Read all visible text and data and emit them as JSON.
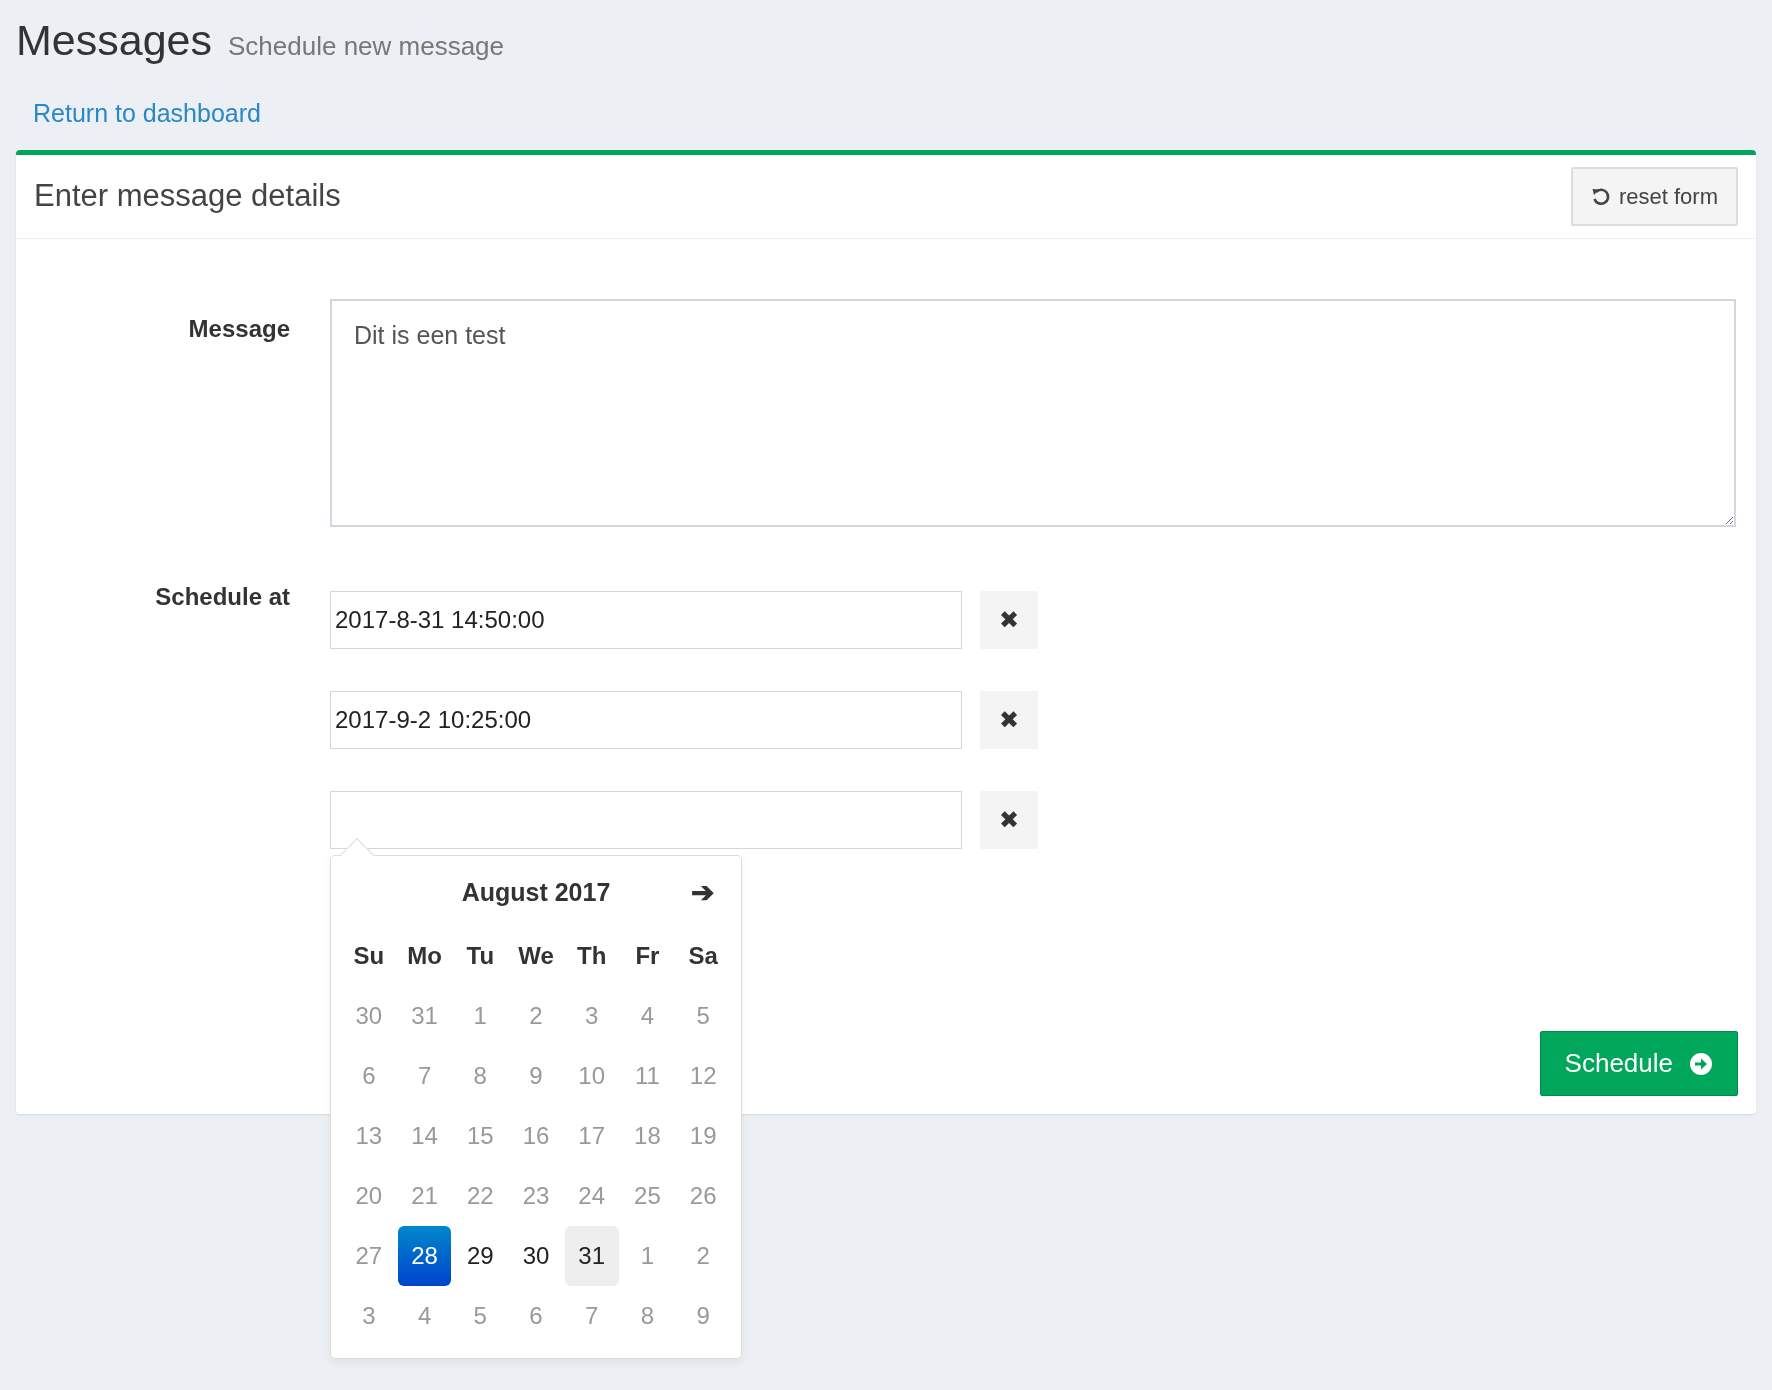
{
  "page": {
    "title": "Messages",
    "subtitle": "Schedule new message"
  },
  "back_link": "Return to dashboard",
  "card": {
    "title": "Enter message details",
    "reset_button": "reset form"
  },
  "message": {
    "label": "Message",
    "value": "Dit is een test"
  },
  "schedule": {
    "label": "Schedule at",
    "remove_label": "✖",
    "fields": [
      {
        "value": "2017-8-31 14:50:00"
      },
      {
        "value": "2017-9-2 10:25:00"
      },
      {
        "datepicker": {
          "month": "August 2017",
          "next": "➔",
          "weekdays": [
            "Su",
            "Mo",
            "Tu",
            "We",
            "Th",
            "Fr",
            "Sa"
          ],
          "weeks": [
            [
              {
                "label": "30",
                "disabled": true,
                "selected": false,
                "highlighted": false
              },
              {
                "label": "31",
                "disabled": true,
                "selected": false,
                "highlighted": false
              },
              {
                "label": "1",
                "disabled": true,
                "selected": false,
                "highlighted": false
              },
              {
                "label": "2",
                "disabled": true,
                "selected": false,
                "highlighted": false
              },
              {
                "label": "3",
                "disabled": true,
                "selected": false,
                "highlighted": false
              },
              {
                "label": "4",
                "disabled": true,
                "selected": false,
                "highlighted": false
              },
              {
                "label": "5",
                "disabled": true,
                "selected": false,
                "highlighted": false
              }
            ],
            [
              {
                "label": "6",
                "disabled": true,
                "selected": false,
                "highlighted": false
              },
              {
                "label": "7",
                "disabled": true,
                "selected": false,
                "highlighted": false
              },
              {
                "label": "8",
                "disabled": true,
                "selected": false,
                "highlighted": false
              },
              {
                "label": "9",
                "disabled": true,
                "selected": false,
                "highlighted": false
              },
              {
                "label": "10",
                "disabled": true,
                "selected": false,
                "highlighted": false
              },
              {
                "label": "11",
                "disabled": true,
                "selected": false,
                "highlighted": false
              },
              {
                "label": "12",
                "disabled": true,
                "selected": false,
                "highlighted": false
              }
            ],
            [
              {
                "label": "13",
                "disabled": true,
                "selected": false,
                "highlighted": false
              },
              {
                "label": "14",
                "disabled": true,
                "selected": false,
                "highlighted": false
              },
              {
                "label": "15",
                "disabled": true,
                "selected": false,
                "highlighted": false
              },
              {
                "label": "16",
                "disabled": true,
                "selected": false,
                "highlighted": false
              },
              {
                "label": "17",
                "disabled": true,
                "selected": false,
                "highlighted": false
              },
              {
                "label": "18",
                "disabled": true,
                "selected": false,
                "highlighted": false
              },
              {
                "label": "19",
                "disabled": true,
                "selected": false,
                "highlighted": false
              }
            ],
            [
              {
                "label": "20",
                "disabled": true,
                "selected": false,
                "highlighted": false
              },
              {
                "label": "21",
                "disabled": true,
                "selected": false,
                "highlighted": false
              },
              {
                "label": "22",
                "disabled": true,
                "selected": false,
                "highlighted": false
              },
              {
                "label": "23",
                "disabled": true,
                "selected": false,
                "highlighted": false
              },
              {
                "label": "24",
                "disabled": true,
                "selected": false,
                "highlighted": false
              },
              {
                "label": "25",
                "disabled": true,
                "selected": false,
                "highlighted": false
              },
              {
                "label": "26",
                "disabled": true,
                "selected": false,
                "highlighted": false
              }
            ],
            [
              {
                "label": "27",
                "disabled": true,
                "selected": false,
                "highlighted": false
              },
              {
                "label": "28",
                "disabled": false,
                "selected": true,
                "highlighted": false
              },
              {
                "label": "29",
                "disabled": false,
                "selected": false,
                "highlighted": false
              },
              {
                "label": "30",
                "disabled": false,
                "selected": false,
                "highlighted": false
              },
              {
                "label": "31",
                "disabled": false,
                "selected": false,
                "highlighted": true
              },
              {
                "label": "1",
                "disabled": true,
                "selected": false,
                "highlighted": false
              },
              {
                "label": "2",
                "disabled": true,
                "selected": false,
                "highlighted": false
              }
            ],
            [
              {
                "label": "3",
                "disabled": true,
                "selected": false,
                "highlighted": false
              },
              {
                "label": "4",
                "disabled": true,
                "selected": false,
                "highlighted": false
              },
              {
                "label": "5",
                "disabled": true,
                "selected": false,
                "highlighted": false
              },
              {
                "label": "6",
                "disabled": true,
                "selected": false,
                "highlighted": false
              },
              {
                "label": "7",
                "disabled": true,
                "selected": false,
                "highlighted": false
              },
              {
                "label": "8",
                "disabled": true,
                "selected": false,
                "highlighted": false
              },
              {
                "label": "9",
                "disabled": true,
                "selected": false,
                "highlighted": false
              }
            ]
          ]
        }
      }
    ]
  },
  "submit_button": "Schedule"
}
